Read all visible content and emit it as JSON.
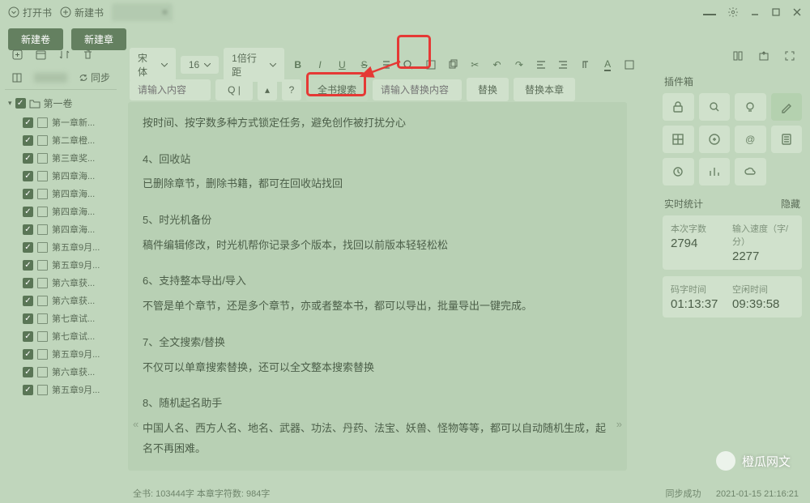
{
  "titlebar": {
    "open_label": "打开书",
    "new_label": "新建书",
    "tab_name": "    ",
    "tab_close": "×"
  },
  "toprow": {
    "new_volume": "新建卷",
    "new_chapter": "新建章"
  },
  "toolbar": {
    "font": "宋体",
    "font_size": "16",
    "line_height": "1倍行距"
  },
  "searchbar": {
    "search_placeholder": "请输入内容",
    "q_label": "Q |",
    "question": "?",
    "full_search": "全书搜索",
    "replace_placeholder": "请输入替换内容",
    "replace": "替换",
    "replace_chapter": "替换本章"
  },
  "left": {
    "sync": "同步",
    "book_title": "       ",
    "volume": "第一卷",
    "chapters": [
      "第一章新...",
      "第二章橙...",
      "第三章奖...",
      "第四章海...",
      "第四章海...",
      "第四章海...",
      "第四章海...",
      "第五章9月...",
      "第五章9月...",
      "第六章获...",
      "第六章获...",
      "第七章试...",
      "第七章试...",
      "第五章9月...",
      "第六章获...",
      "第五章9月..."
    ]
  },
  "editor": {
    "lines": [
      "按时间、按字数多种方式锁定任务，避免创作被打扰分心",
      "",
      "4、回收站",
      "已删除章节，删除书籍，都可在回收站找回",
      "",
      "5、时光机备份",
      "稿件编辑修改，时光机帮你记录多个版本，找回以前版本轻轻松松",
      "",
      "6、支持整本导出/导入",
      "不管是单个章节，还是多个章节，亦或者整本书，都可以导出，批量导出一键完成。",
      "",
      "7、全文搜索/替换",
      "不仅可以单章搜索替换，还可以全文整本搜索替换",
      "",
      "8、随机起名助手",
      "中国人名、西方人名、地名、武器、功法、丹药、法宝、妖兽、怪物等等，都可以自动随机生成，起名不再困难。"
    ]
  },
  "right": {
    "plugin_label": "插件箱",
    "stats_label": "实时统计",
    "hide_label": "隐藏",
    "stat1_a_label": "本次字数",
    "stat1_b_label": "输入速度（字/分）",
    "stat1_a_val": "2794",
    "stat1_b_val": "2277",
    "stat2_a_label": "码字时间",
    "stat2_b_label": "空闲时间",
    "stat2_a_val": "01:13:37",
    "stat2_b_val": "09:39:58"
  },
  "status": {
    "left": "全书: 103444字    本章字符数: 984字",
    "sync": "同步成功",
    "time": "2021-01-15 21:16:21"
  },
  "watermark": "橙瓜网文"
}
